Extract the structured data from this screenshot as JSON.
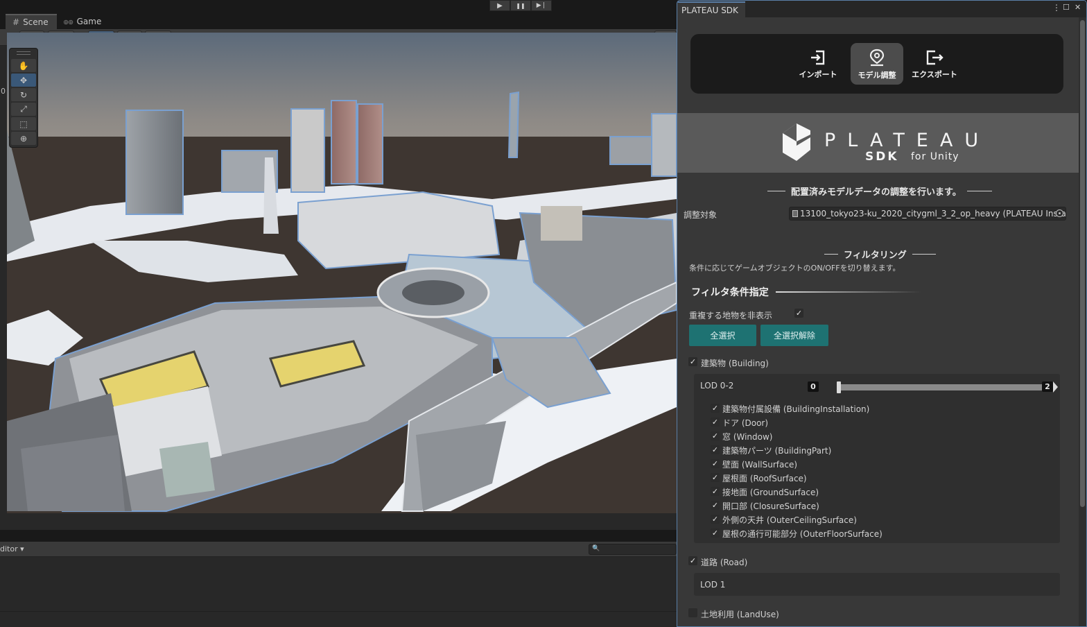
{
  "toolbar": {
    "play_glyph": "▶",
    "pause_glyph": "❚❚",
    "step_glyph": "▶❘"
  },
  "scene_panel": {
    "tabs": [
      {
        "label": "Scene",
        "icon": "grid-icon",
        "glyph": "#"
      },
      {
        "label": "Game",
        "icon": "gamepad-icon",
        "glyph": "◎◎"
      }
    ],
    "tool_buttons": [
      {
        "name": "draw-mode-button",
        "glyph": "◿ ▾"
      },
      {
        "name": "shading-mode-button",
        "glyph": "⬡ ▾"
      },
      {
        "name": "grid-snap-button",
        "glyph": "## ▾"
      },
      {
        "name": "grid-button",
        "glyph": "⋕ ▾"
      },
      {
        "name": "increment-snap-button",
        "glyph": "|‖| ▾"
      },
      {
        "name": "gizmos-button",
        "glyph": "◐ ▾"
      }
    ],
    "gizmo_tools": [
      {
        "name": "hand-tool-icon",
        "glyph": "✋",
        "active": false
      },
      {
        "name": "move-tool-icon",
        "glyph": "✥",
        "active": true
      },
      {
        "name": "rotate-tool-icon",
        "glyph": "↻",
        "active": false
      },
      {
        "name": "scale-tool-icon",
        "glyph": "⤢",
        "active": false
      },
      {
        "name": "rect-tool-icon",
        "glyph": "⬚",
        "active": false
      },
      {
        "name": "transform-tool-icon",
        "glyph": "⊕",
        "active": false
      }
    ],
    "left_edge_number": "0"
  },
  "console": {
    "editor_label": "ditor ▾",
    "search_glyph": "🔍"
  },
  "sdk": {
    "title": "PLATEAU SDK",
    "menu_glyph": "⋮",
    "maximize_glyph": "☐",
    "close_glyph": "✕",
    "modes": [
      {
        "label": "インポート",
        "icon": "import-icon",
        "active": false
      },
      {
        "label": "モデル調整",
        "icon": "model-adjust-icon",
        "active": true
      },
      {
        "label": "エクスポート",
        "icon": "export-icon",
        "active": false
      }
    ],
    "logo": {
      "word": "PLATEAU",
      "sub1": "SDK",
      "sub2": "for Unity"
    },
    "heading": "配置済みモデルデータの調整を行います。",
    "target_label": "調整対象",
    "target_value": "13100_tokyo23-ku_2020_citygml_3_2_op_heavy (PLATEAU Insta",
    "filtering_heading": "フィルタリング",
    "filtering_desc": "条件に応じてゲームオブジェクトのON/OFFを切り替えます。",
    "filter_spec": "フィルタ条件指定",
    "hide_duplicates_label": "重複する地物を非表示",
    "hide_duplicates_checked": true,
    "select_all": "全選択",
    "deselect_all": "全選択解除",
    "building": {
      "label": "建築物 (Building)",
      "checked": true,
      "lod_label": "LOD 0-2",
      "lod_min": "0",
      "lod_max": "2",
      "sub_items": [
        "建築物付属設備 (BuildingInstallation)",
        "ドア (Door)",
        "窓 (Window)",
        "建築物パーツ (BuildingPart)",
        "壁面 (WallSurface)",
        "屋根面 (RoofSurface)",
        "接地面 (GroundSurface)",
        "開口部 (ClosureSurface)",
        "外側の天井 (OuterCeilingSurface)",
        "屋根の通行可能部分 (OuterFloorSurface)"
      ]
    },
    "road": {
      "label": "道路 (Road)",
      "checked": true,
      "lod_label": "LOD 1"
    },
    "landuse": {
      "label": "土地利用 (LandUse)",
      "checked": false
    },
    "check_glyph": "✓"
  }
}
